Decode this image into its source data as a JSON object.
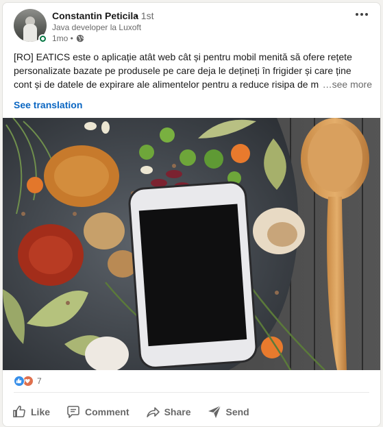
{
  "post": {
    "author": {
      "name": "Constantin Peticila",
      "degree": "• 1st",
      "headline": "Java developer la Luxoft",
      "time": "1mo •"
    },
    "text_lines": [
      "[RO] EATICS este o aplicație atât web cât și pentru mobil menită să ofere rețete",
      "personalizate bazate pe produsele pe care deja le dețineți în frigider și care ține",
      "cont și de datele de expirare ale alimentelor pentru a reduce risipa de m"
    ],
    "see_more": "…see more",
    "see_translation": "See translation",
    "reactions": {
      "icons": [
        "like-icon",
        "love-icon"
      ],
      "count": "7"
    },
    "actions": {
      "like": "Like",
      "comment": "Comment",
      "share": "Share",
      "send": "Send"
    }
  },
  "colors": {
    "link": "#0a66c2",
    "online": "#057642",
    "like": "#378fe9",
    "love": "#df704d"
  }
}
